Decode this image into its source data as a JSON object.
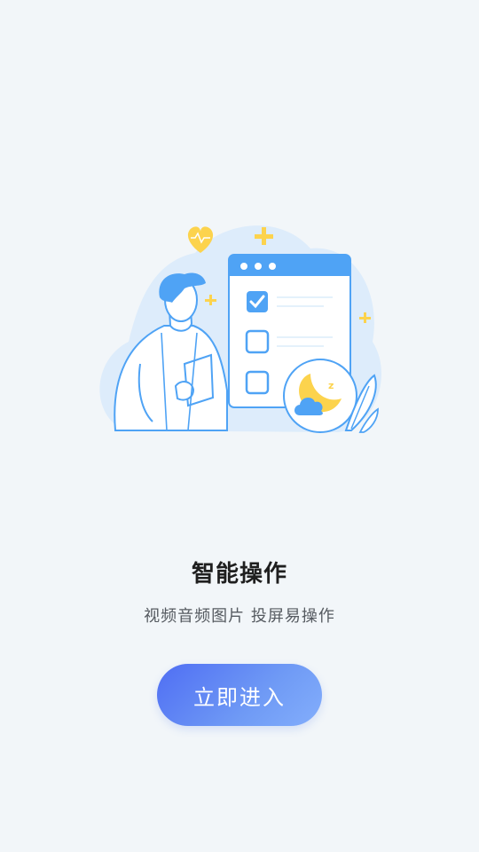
{
  "onboarding": {
    "title": "智能操作",
    "subtitle": "视频音频图片  投屏易操作",
    "enter_button_label": "立即进入"
  },
  "illustration": {
    "icons": [
      "heart-icon",
      "plus-icon",
      "checkbox-checked-icon",
      "checkbox-empty-icon",
      "moon-cloud-icon",
      "leaf-icon",
      "person-icon"
    ],
    "colors": {
      "accent_blue": "#4fa3f5",
      "light_blue": "#ddecfb",
      "yellow": "#fbd44b",
      "button_gradient_start": "#4f6ef3",
      "button_gradient_end": "#83aefc"
    }
  }
}
